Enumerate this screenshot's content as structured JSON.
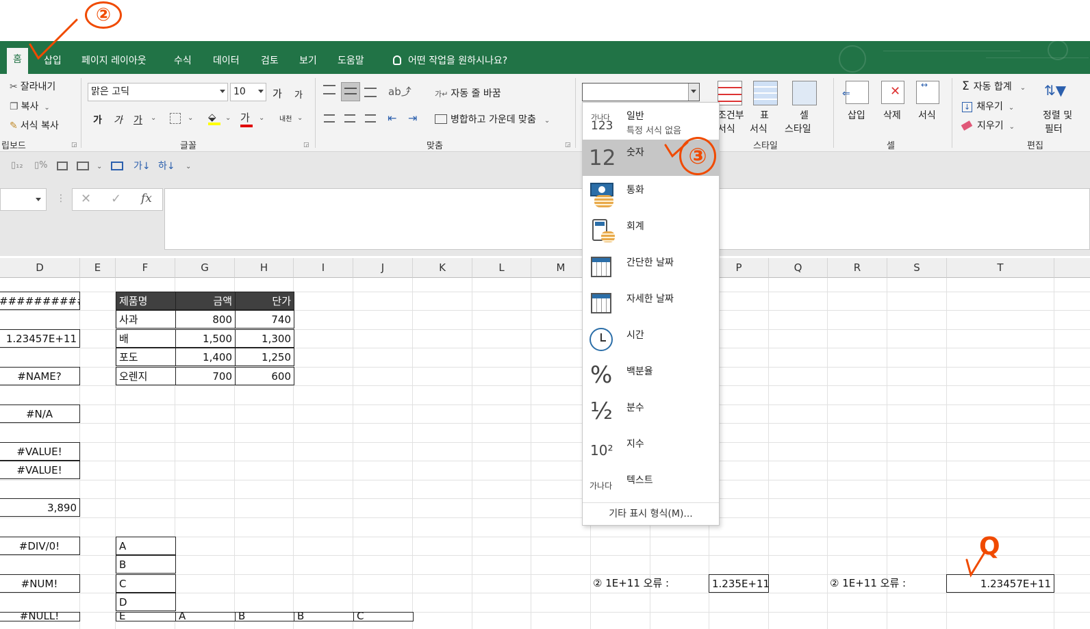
{
  "tabs": [
    "홈",
    "삽입",
    "페이지 레이아웃",
    "수식",
    "데이터",
    "검토",
    "보기",
    "도움말"
  ],
  "tell_me": "어떤 작업을 원하시나요?",
  "clipboard": {
    "cut": "잘라내기",
    "copy": "복사",
    "format_painter": "서식 복사",
    "group": "립보드"
  },
  "font": {
    "name": "맑은 고딕",
    "size": "10",
    "grow": "가",
    "shrink": "가",
    "bold": "가",
    "italic": "가",
    "underline": "가",
    "color_glyph": "가",
    "phonetic": "내천",
    "group": "글꼴"
  },
  "alignment": {
    "wrap": "자동 줄 바꿈",
    "merge": "병합하고 가운데 맞춤",
    "group": "맞춤"
  },
  "number": {
    "format_value": ""
  },
  "styles": {
    "conditional_line1": "조건부",
    "conditional_line2": "서식",
    "table_line1": "표",
    "table_line2": "서식",
    "cell_line1": "셀",
    "cell_line2": "스타일",
    "group": "스타일"
  },
  "cells": {
    "insert": "삽입",
    "delete": "삭제",
    "format": "서식",
    "group": "셀"
  },
  "editing": {
    "autosum": "자동 합계",
    "fill": "채우기",
    "clear": "지우기",
    "sort_line1": "정렬 및",
    "sort_line2": "필터",
    "group": "편집"
  },
  "formula_bar": {
    "fx": "fx",
    "cancel": "✕",
    "enter": "✓"
  },
  "columns": [
    "D",
    "E",
    "F",
    "G",
    "H",
    "I",
    "J",
    "K",
    "L",
    "M",
    "P",
    "Q",
    "R",
    "S",
    "T"
  ],
  "col_d_values": [
    "############",
    "1.23457E+11",
    "#NAME?",
    "#N/A",
    "#VALUE!",
    "#VALUE!",
    "3,890",
    "#DIV/0!",
    "#NUM!",
    "#NULL!"
  ],
  "product_table": {
    "headers": [
      "제품명",
      "금액",
      "단가"
    ],
    "rows": [
      [
        "사과",
        "800",
        "740"
      ],
      [
        "배",
        "1,500",
        "1,300"
      ],
      [
        "포도",
        "1,400",
        "1,250"
      ],
      [
        "오렌지",
        "700",
        "600"
      ]
    ]
  },
  "letters": [
    "A",
    "B",
    "C",
    "D",
    "E"
  ],
  "row13_labels": [
    "A",
    "B",
    "B",
    "C"
  ],
  "error_label_1": "② 1E+11 오류 :",
  "error_value_1": "1.235E+11",
  "error_label_2": "② 1E+11 오류 :",
  "error_value_2": "1.23457E+11",
  "dropdown": {
    "items": [
      {
        "label": "일반",
        "sub": "특정 서식 없음",
        "icon_text": "가나다",
        "icon_text2": "123"
      },
      {
        "label": "숫자",
        "icon_text": "12"
      },
      {
        "label": "통화"
      },
      {
        "label": "회계"
      },
      {
        "label": "간단한 날짜"
      },
      {
        "label": "자세한 날짜"
      },
      {
        "label": "시간"
      },
      {
        "label": "백분율",
        "icon_text": "%"
      },
      {
        "label": "분수",
        "icon_text": "½"
      },
      {
        "label": "지수",
        "icon_text": "10²"
      },
      {
        "label": "텍스트",
        "icon_text": "가나다"
      }
    ],
    "more": "기타 표시 형식(M)..."
  },
  "annotations": {
    "step2": "②",
    "step3": "③",
    "stepQ": "Q"
  },
  "colors": {
    "excel_green": "#217346",
    "highlight": "#c6c6c6",
    "annotation": "#f04a00"
  }
}
